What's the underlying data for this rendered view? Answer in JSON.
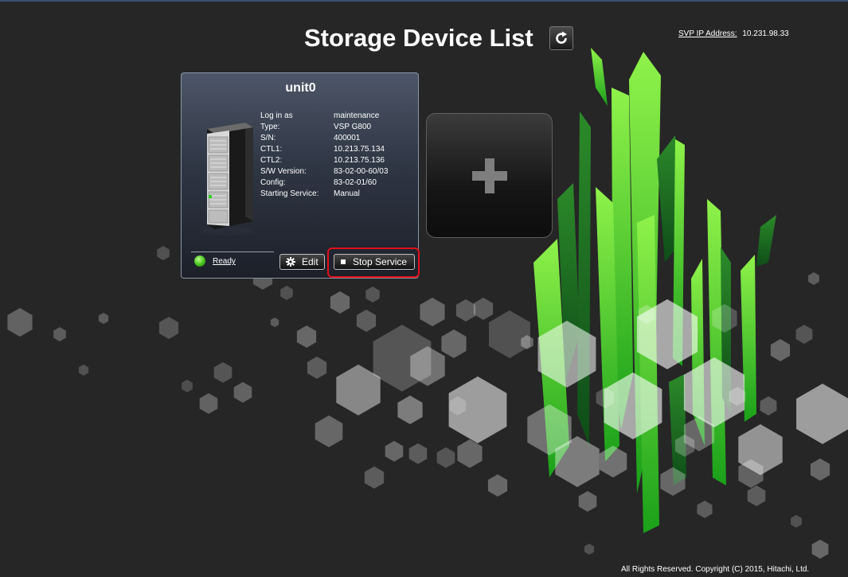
{
  "header": {
    "title": "Storage Device List",
    "refresh_icon": "refresh-icon",
    "svp_label": "SVP IP Address:",
    "svp_value": "10.231.98.33"
  },
  "device": {
    "name": "unit0",
    "image_icon": "server-rack-icon",
    "info": [
      {
        "label": "Log in as",
        "value": "maintenance"
      },
      {
        "label": "Type:",
        "value": "VSP G800"
      },
      {
        "label": "S/N:",
        "value": "400001"
      },
      {
        "label": "CTL1:",
        "value": "10.213.75.134"
      },
      {
        "label": "CTL2:",
        "value": "10.213.75.136"
      },
      {
        "label": "S/W Version:",
        "value": "83-02-00-60/03"
      },
      {
        "label": "Config:",
        "value": "83-02-01/60"
      },
      {
        "label": "Starting Service:",
        "value": "Manual"
      }
    ],
    "status": "Ready",
    "status_color": "#44c21a",
    "edit_label": "Edit",
    "edit_icon": "gear-icon",
    "stop_label": "Stop Service",
    "stop_icon": "stop-square-icon",
    "highlight_color": "#e0101a"
  },
  "add_tile": {
    "icon": "plus-icon"
  },
  "footer": {
    "copyright": "All Rights Reserved. Copyright (C) 2015, Hitachi, Ltd."
  },
  "colors": {
    "accent_green": "#3fd42a",
    "background": "#262626"
  }
}
